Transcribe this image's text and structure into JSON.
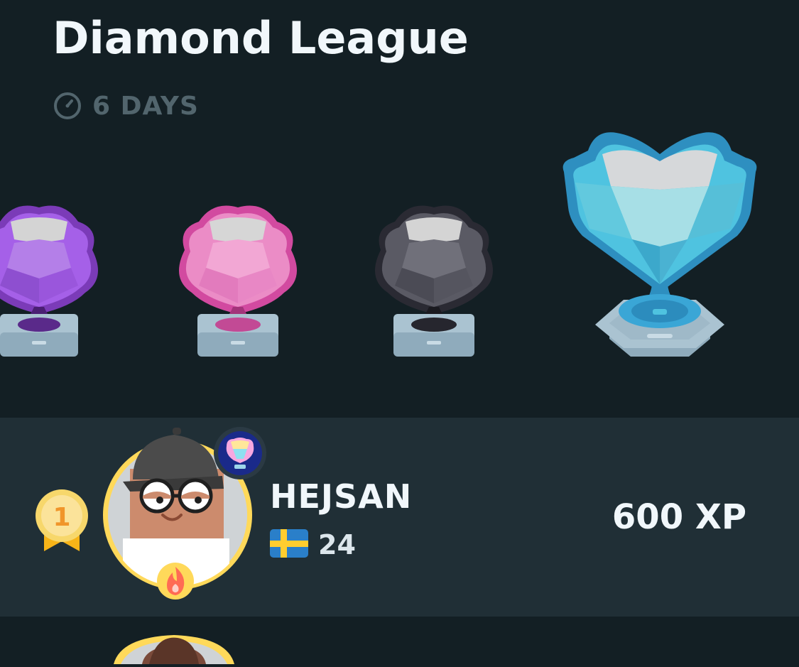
{
  "header": {
    "title": "Diamond League",
    "timer_icon": "timer-icon",
    "timer_text": "6 DAYS"
  },
  "trophies": [
    {
      "name": "amethyst-trophy-icon",
      "color": "#a560e8"
    },
    {
      "name": "pearl-trophy-icon",
      "color": "#e55fb3"
    },
    {
      "name": "obsidian-trophy-icon",
      "color": "#4b4b55"
    },
    {
      "name": "diamond-trophy-icon",
      "color": "#4fb8dc",
      "current": true
    }
  ],
  "leaderboard": {
    "rows": [
      {
        "rank": "1",
        "username": "HEJSAN",
        "country_icon": "sweden-flag-icon",
        "streak_count": "24",
        "xp": "600 XP"
      }
    ]
  },
  "colors": {
    "background": "#131f24",
    "row_highlight": "#202f36",
    "muted": "#52656d",
    "gold": "#ffc800"
  }
}
